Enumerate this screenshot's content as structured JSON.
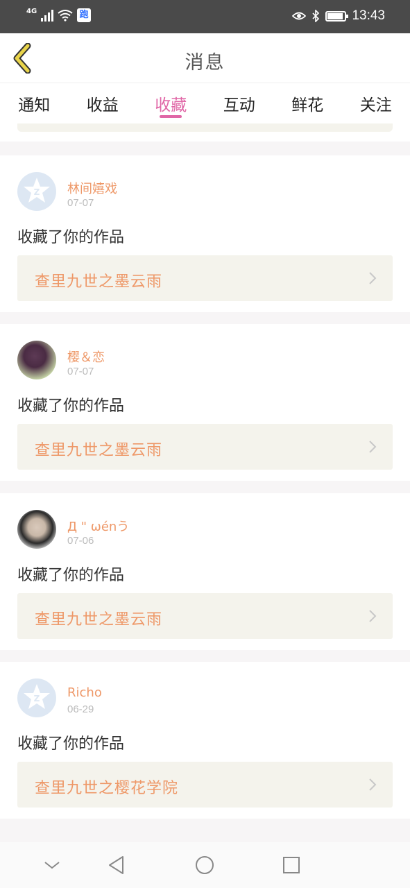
{
  "status_bar": {
    "network": "4G",
    "time": "13:43",
    "app_badge": "跑",
    "icons": [
      "signal-icon",
      "wifi-icon",
      "baidu-icon",
      "eye-icon",
      "bluetooth-icon",
      "battery-icon"
    ]
  },
  "header": {
    "title": "消息",
    "back_icon": "chevron-left-icon"
  },
  "tabs": [
    {
      "label": "通知",
      "active": false
    },
    {
      "label": "收益",
      "active": false
    },
    {
      "label": "收藏",
      "active": true
    },
    {
      "label": "互动",
      "active": false
    },
    {
      "label": "鲜花",
      "active": false
    },
    {
      "label": "关注",
      "active": false
    }
  ],
  "messages": [
    {
      "username": "林间嬉戏",
      "date": "07-07",
      "action": "收藏了你的作品",
      "work": "查里九世之墨云雨",
      "avatar": "default-avatar"
    },
    {
      "username": "樱＆恋",
      "date": "07-07",
      "action": "收藏了你的作品",
      "work": "查里九世之墨云雨",
      "avatar": "flowers-avatar"
    },
    {
      "username": "Д \" ωénう",
      "date": "07-06",
      "action": "收藏了你的作品",
      "work": "查里九世之墨云雨",
      "avatar": "photo-avatar"
    },
    {
      "username": "Richo",
      "date": "06-29",
      "action": "收藏了你的作品",
      "work": "查里九世之樱花学院",
      "avatar": "default-avatar"
    }
  ],
  "colors": {
    "accent": "#e066a6",
    "username": "#ee9868",
    "work_bg": "#f4f3ec",
    "status_bar": "#4a4a4a"
  },
  "nav_bar": [
    "chevron-down-icon",
    "back-triangle-icon",
    "home-circle-icon",
    "recents-square-icon"
  ]
}
